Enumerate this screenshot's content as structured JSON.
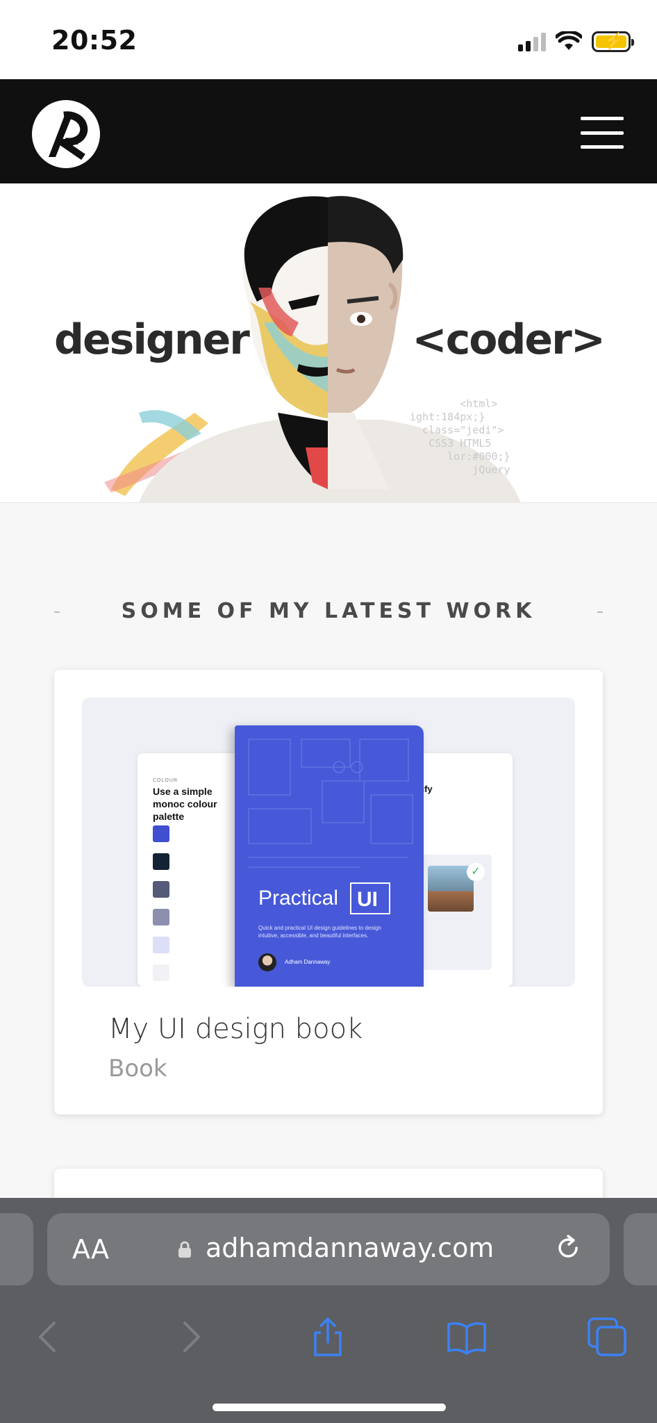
{
  "status": {
    "time": "20:52"
  },
  "hero": {
    "left_word": "designer",
    "right_word": "<coder>"
  },
  "section": {
    "title": "SOME OF MY LATEST WORK"
  },
  "card": {
    "title": "My UI design book",
    "subtitle": "Book",
    "book": {
      "title_word1": "Practical",
      "title_word2": "UI",
      "tagline": "Quick and practical UI design guidelines to design intuitive, accessible, and beautiful interfaces.",
      "author": "Adham Dannaway",
      "left_page_label": "COLOUR",
      "left_page_heading": "Use a simple monoc colour palette",
      "right_page_heading": "nplify"
    }
  },
  "browser": {
    "text_size_label": "AA",
    "url": "adhamdannaway.com"
  },
  "icons": {
    "signal": "signal-icon",
    "wifi": "wifi-icon",
    "battery": "battery-charging-icon",
    "menu": "hamburger-menu-icon",
    "lock": "lock-icon",
    "reload": "reload-icon",
    "back": "chevron-left-icon",
    "forward": "chevron-right-icon",
    "share": "share-icon",
    "bookmarks": "book-icon",
    "tabs": "tabs-icon"
  },
  "colors": {
    "header_bg": "#101010",
    "book_blue": "#4759d8",
    "browser_bg": "#5d5e62",
    "accent_blue": "#3b82f6"
  }
}
